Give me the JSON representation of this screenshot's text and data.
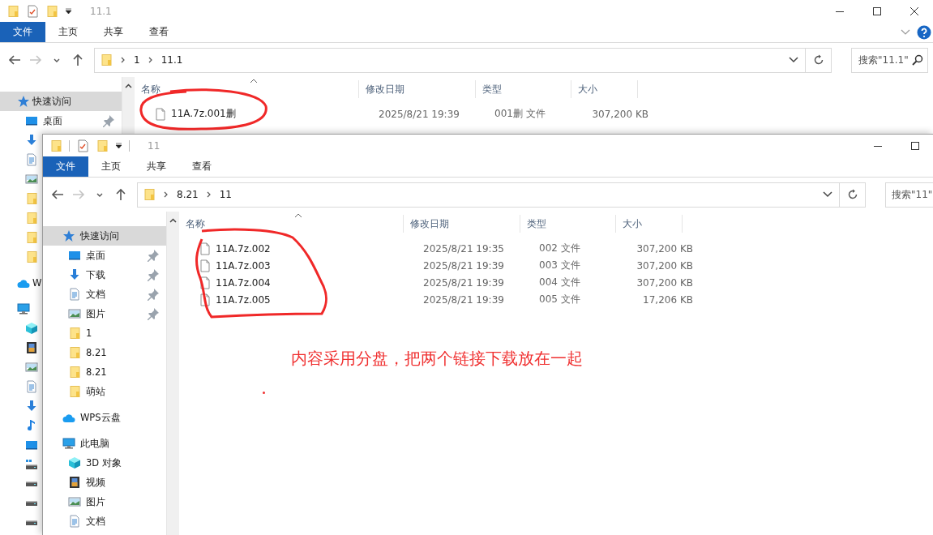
{
  "windows": [
    {
      "title": "11.1",
      "ribbon_tabs": [
        {
          "label": "文件",
          "kind": "file"
        },
        {
          "label": "主页",
          "kind": "tab"
        },
        {
          "label": "共享",
          "kind": "tab"
        },
        {
          "label": "查看",
          "kind": "tab"
        }
      ],
      "ribbon_help": true,
      "nav_buttons": [
        {
          "kind": "back",
          "disabled": false
        },
        {
          "kind": "forward",
          "disabled": true
        },
        {
          "kind": "recent",
          "disabled": false
        },
        {
          "kind": "up",
          "disabled": false
        }
      ],
      "breadcrumb": [
        "1",
        "11.1"
      ],
      "search": {
        "placeholder": "搜索\"11.1\"",
        "show_icon": true
      },
      "sidebar": [
        {
          "kind": "star",
          "label": "快速访问",
          "selected": true,
          "children": [
            {
              "kind": "desktop",
              "label": "桌面",
              "pinned": true,
              "selected": false
            },
            {
              "kind": "download",
              "pinned": false,
              "selected": false
            },
            {
              "kind": "document",
              "pinned": false,
              "selected": false
            },
            {
              "kind": "picture",
              "pinned": false,
              "selected": false
            },
            {
              "kind": "folder",
              "pinned": false,
              "selected": false
            },
            {
              "kind": "folder",
              "pinned": false,
              "selected": false
            },
            {
              "kind": "folder",
              "pinned": false,
              "selected": false
            },
            {
              "kind": "folder",
              "pinned": false,
              "selected": false
            }
          ]
        },
        {
          "kind": "cloud",
          "label": "W",
          "selected": false
        },
        {
          "kind": "pc",
          "selected": false,
          "children": [
            {
              "kind": "cube",
              "selected": false
            },
            {
              "kind": "video",
              "selected": false
            },
            {
              "kind": "picture",
              "selected": false
            },
            {
              "kind": "document",
              "selected": false
            },
            {
              "kind": "download",
              "selected": false
            },
            {
              "kind": "music",
              "selected": false
            },
            {
              "kind": "desktop",
              "selected": false
            },
            {
              "kind": "netdrive",
              "selected": false
            },
            {
              "kind": "drive",
              "selected": false
            },
            {
              "kind": "drive",
              "selected": false
            },
            {
              "kind": "drive",
              "selected": false
            }
          ]
        }
      ],
      "columns": [
        {
          "label": "名称",
          "sorted": true
        },
        {
          "label": "修改日期",
          "sorted": false
        },
        {
          "label": "类型",
          "sorted": false
        },
        {
          "label": "大小",
          "sorted": false
        }
      ],
      "files": [
        {
          "name": "11A.7z.001删",
          "date": "2025/8/21 19:39",
          "type": "001删 文件",
          "size": "307,200 KB"
        }
      ],
      "circled": true
    },
    {
      "title": "11",
      "ribbon_tabs": [
        {
          "label": "文件",
          "kind": "file"
        },
        {
          "label": "主页",
          "kind": "tab"
        },
        {
          "label": "共享",
          "kind": "tab"
        },
        {
          "label": "查看",
          "kind": "tab"
        }
      ],
      "ribbon_help": false,
      "nav_buttons": [
        {
          "kind": "back",
          "disabled": false
        },
        {
          "kind": "forward",
          "disabled": true
        },
        {
          "kind": "recent",
          "disabled": false
        },
        {
          "kind": "up",
          "disabled": false
        }
      ],
      "breadcrumb": [
        "8.21",
        "11"
      ],
      "search": {
        "placeholder": "搜索\"11\"",
        "show_icon": false
      },
      "sidebar": [
        {
          "kind": "star",
          "label": "快速访问",
          "selected": true,
          "children": [
            {
              "kind": "desktop",
              "label": "桌面",
              "pinned": true,
              "selected": false
            },
            {
              "kind": "download",
              "label": "下载",
              "pinned": true,
              "selected": false
            },
            {
              "kind": "document",
              "label": "文档",
              "pinned": true,
              "selected": false
            },
            {
              "kind": "picture",
              "label": "图片",
              "pinned": true,
              "selected": false
            },
            {
              "kind": "folder",
              "label": "1",
              "pinned": false,
              "selected": false
            },
            {
              "kind": "folder",
              "label": "8.21",
              "pinned": false,
              "selected": false
            },
            {
              "kind": "folder",
              "label": "8.21",
              "pinned": false,
              "selected": false
            },
            {
              "kind": "folder",
              "label": "萌站",
              "pinned": false,
              "selected": false
            }
          ]
        },
        {
          "kind": "cloud",
          "label": "WPS云盘",
          "selected": false
        },
        {
          "kind": "pc",
          "label": "此电脑",
          "selected": false,
          "children": [
            {
              "kind": "cube",
              "label": "3D 对象",
              "selected": false
            },
            {
              "kind": "video",
              "label": "视频",
              "selected": false
            },
            {
              "kind": "picture",
              "label": "图片",
              "selected": false
            },
            {
              "kind": "document",
              "label": "文档",
              "selected": false
            }
          ]
        }
      ],
      "columns": [
        {
          "label": "名称",
          "sorted": true
        },
        {
          "label": "修改日期",
          "sorted": false
        },
        {
          "label": "类型",
          "sorted": false
        },
        {
          "label": "大小",
          "sorted": false
        }
      ],
      "files": [
        {
          "name": "11A.7z.002",
          "date": "2025/8/21 19:35",
          "type": "002 文件",
          "size": "307,200 KB"
        },
        {
          "name": "11A.7z.003",
          "date": "2025/8/21 19:39",
          "type": "003 文件",
          "size": "307,200 KB"
        },
        {
          "name": "11A.7z.004",
          "date": "2025/8/21 19:39",
          "type": "004 文件",
          "size": "307,200 KB"
        },
        {
          "name": "11A.7z.005",
          "date": "2025/8/21 19:39",
          "type": "005 文件",
          "size": "17,206 KB"
        }
      ],
      "circled": true,
      "annotation": {
        "text": "内容采用分盘，把两个链接下载放在一起"
      }
    }
  ]
}
